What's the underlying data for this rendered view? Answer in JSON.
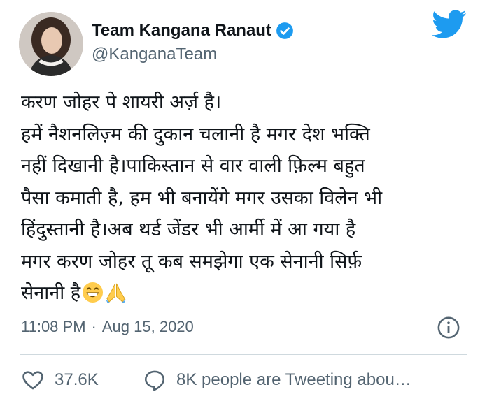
{
  "tweet": {
    "author_name": "Team Kangana Ranaut",
    "handle": "@KanganaTeam",
    "lines": [
      "करण जोहर पे शायरी अर्ज़ है।",
      "हमें नैशनलिज़्म की दुकान चलानी है मगर देश भक्ति",
      "नहीं दिखानी है।पाकिस्तान से वार वाली फ़िल्म बहुत",
      "पैसा कमाती है, हम भी बनायेंगे मगर उसका विलेन भी",
      "हिंदुस्तानी है।अब थर्ड जेंडर भी आर्मी में आ गया है",
      "मगर करण जोहर तू कब समझेगा एक सेनानी सिर्फ़",
      "सेनानी है"
    ],
    "time": "11:08 PM",
    "separator": "·",
    "date": "Aug 15, 2020"
  },
  "actions": {
    "likes": "37.6K",
    "talking": "8K people are Tweeting abou…"
  },
  "icons": {
    "verified": "verified-badge-icon",
    "logo": "twitter-bird-icon",
    "info": "info-icon",
    "like": "heart-icon",
    "talk": "speech-bubble-icon",
    "emoji1": "grinning-face-emoji",
    "emoji2": "folded-hands-emoji"
  },
  "colors": {
    "brand": "#1d9bf0",
    "text": "#0f1419",
    "secondary": "#536471"
  }
}
